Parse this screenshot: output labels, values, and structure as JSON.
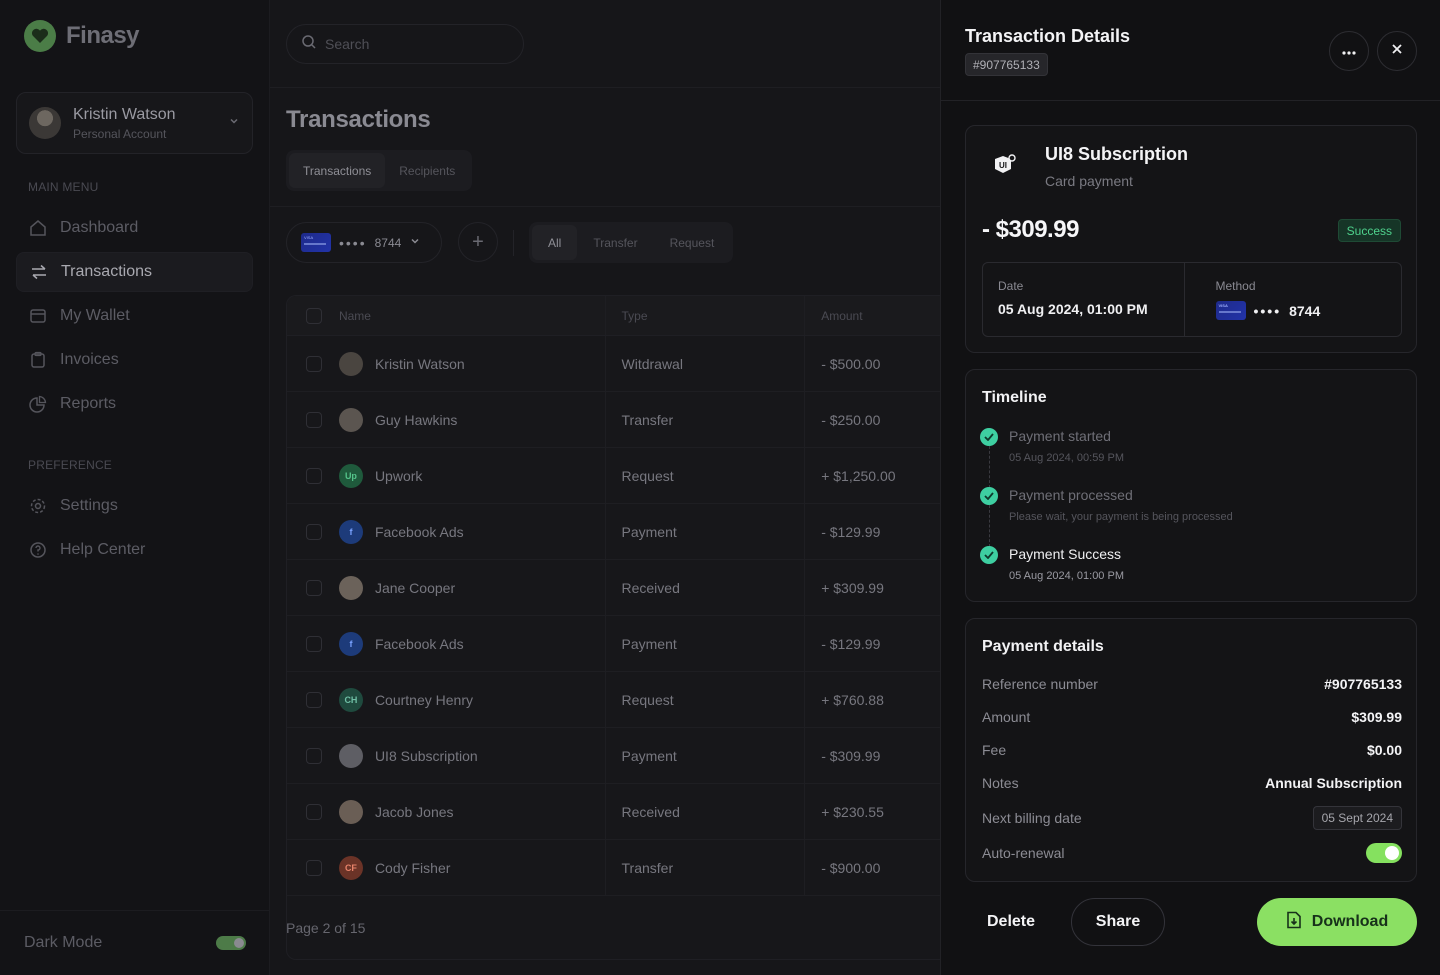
{
  "brand": {
    "name": "Finasy",
    "accent": "#8be063",
    "logo_icon": "heart-icon"
  },
  "account": {
    "name": "Kristin Watson",
    "type": "Personal Account"
  },
  "sidebar": {
    "main_menu_label": "MAIN MENU",
    "preference_label": "PREFERENCE",
    "items": [
      {
        "label": "Dashboard",
        "icon": "home-icon"
      },
      {
        "label": "Transactions",
        "icon": "arrows-icon",
        "active": true
      },
      {
        "label": "My Wallet",
        "icon": "wallet-icon"
      },
      {
        "label": "Invoices",
        "icon": "clipboard-icon"
      },
      {
        "label": "Reports",
        "icon": "pie-chart-icon"
      }
    ],
    "pref_items": [
      {
        "label": "Settings",
        "icon": "gear-icon"
      },
      {
        "label": "Help Center",
        "icon": "help-icon"
      }
    ],
    "dark_mode_label": "Dark Mode"
  },
  "search": {
    "placeholder": "Search"
  },
  "page": {
    "title": "Transactions",
    "tabs": [
      "Transactions",
      "Recipients"
    ],
    "card_last4": "8744",
    "filters": [
      "All",
      "Transfer",
      "Request"
    ]
  },
  "table": {
    "headers": {
      "name": "Name",
      "type": "Type",
      "amount": "Amount"
    },
    "rows": [
      {
        "name": "Kristin Watson",
        "type": "Witdrawal",
        "amount": "- $500.00",
        "initials": "",
        "color": "#4a4540"
      },
      {
        "name": "Guy Hawkins",
        "type": "Transfer",
        "amount": "- $250.00",
        "initials": "",
        "color": "#5b5550"
      },
      {
        "name": "Upwork",
        "type": "Request",
        "amount": "+ $1,250.00",
        "initials": "Up",
        "color": "#1f5a3c"
      },
      {
        "name": "Facebook Ads",
        "type": "Payment",
        "amount": "- $129.99",
        "initials": "f",
        "color": "#1d3b7a"
      },
      {
        "name": "Jane Cooper",
        "type": "Received",
        "amount": "+ $309.99",
        "initials": "",
        "color": "#6b625a"
      },
      {
        "name": "Facebook Ads",
        "type": "Payment",
        "amount": "- $129.99",
        "initials": "f",
        "color": "#1d3b7a"
      },
      {
        "name": "Courtney Henry",
        "type": "Request",
        "amount": "+ $760.88",
        "initials": "CH",
        "color": "#1f4a3e"
      },
      {
        "name": "UI8 Subscription",
        "type": "Payment",
        "amount": "- $309.99",
        "initials": "",
        "color": "#5e5e64"
      },
      {
        "name": "Jacob Jones",
        "type": "Received",
        "amount": "+ $230.55",
        "initials": "",
        "color": "#6a5e55"
      },
      {
        "name": "Cody Fisher",
        "type": "Transfer",
        "amount": "- $900.00",
        "initials": "CF",
        "color": "#6b3327"
      }
    ],
    "pagination": "Page 2 of 15"
  },
  "detail": {
    "title": "Transaction Details",
    "id": "#907765133",
    "merchant": "UI8 Subscription",
    "kind": "Card payment",
    "amount": "- $309.99",
    "status": "Success",
    "date_label": "Date",
    "date": "05 Aug 2024, 01:00 PM",
    "method_label": "Method",
    "method_last4": "8744",
    "timeline_title": "Timeline",
    "timeline": [
      {
        "title": "Payment started",
        "sub": "05 Aug 2024, 00:59 PM"
      },
      {
        "title": "Payment processed",
        "sub": "Please wait, your payment is being processed"
      },
      {
        "title": "Payment Success",
        "sub": "05 Aug 2024, 01:00 PM"
      }
    ],
    "payment_title": "Payment details",
    "payment": [
      {
        "label": "Reference number",
        "value": "#907765133"
      },
      {
        "label": "Amount",
        "value": "$309.99"
      },
      {
        "label": "Fee",
        "value": "$0.00"
      },
      {
        "label": "Notes",
        "value": "Annual Subscription"
      },
      {
        "label": "Next billing date",
        "value": "05 Sept 2024"
      },
      {
        "label": "Auto-renewal",
        "value": ""
      }
    ],
    "auto_renewal_on": true,
    "actions": {
      "delete": "Delete",
      "share": "Share",
      "download": "Download"
    }
  }
}
